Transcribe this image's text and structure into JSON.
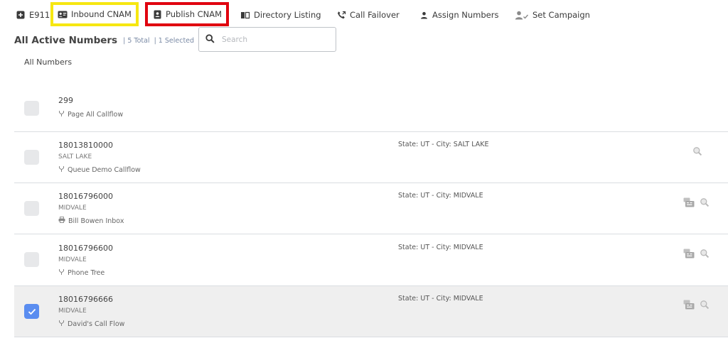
{
  "toolbar": {
    "e911": "E911",
    "inbound_cnam": "Inbound CNAM",
    "publish_cnam": "Publish CNAM",
    "directory_listing": "Directory Listing",
    "call_failover": "Call Failover",
    "assign_numbers": "Assign Numbers",
    "set_campaign": "Set Campaign"
  },
  "header": {
    "title": "All Active Numbers",
    "total": "| 5 Total",
    "selected": "| 1 Selected"
  },
  "search": {
    "placeholder": "Search"
  },
  "section_label": "All Numbers",
  "rows": [
    {
      "number": "299",
      "city": "",
      "flow": "Page All Callflow",
      "state": ""
    },
    {
      "number": "18013810000",
      "city": "SALT LAKE",
      "flow": "Queue Demo Callflow",
      "state": "State: UT - City: SALT LAKE"
    },
    {
      "number": "18016796000",
      "city": "MIDVALE",
      "flow": "Bill Bowen Inbox",
      "state": "State: UT - City: MIDVALE"
    },
    {
      "number": "18016796600",
      "city": "MIDVALE",
      "flow": "Phone Tree",
      "state": "State: UT - City: MIDVALE"
    },
    {
      "number": "18016796666",
      "city": "MIDVALE",
      "flow": "David's Call Flow",
      "state": "State: UT - City: MIDVALE"
    }
  ],
  "colors": {
    "highlight_yellow": "#f6e711",
    "highlight_red": "#e0000f",
    "checkbox_checked": "#5a8df0"
  }
}
